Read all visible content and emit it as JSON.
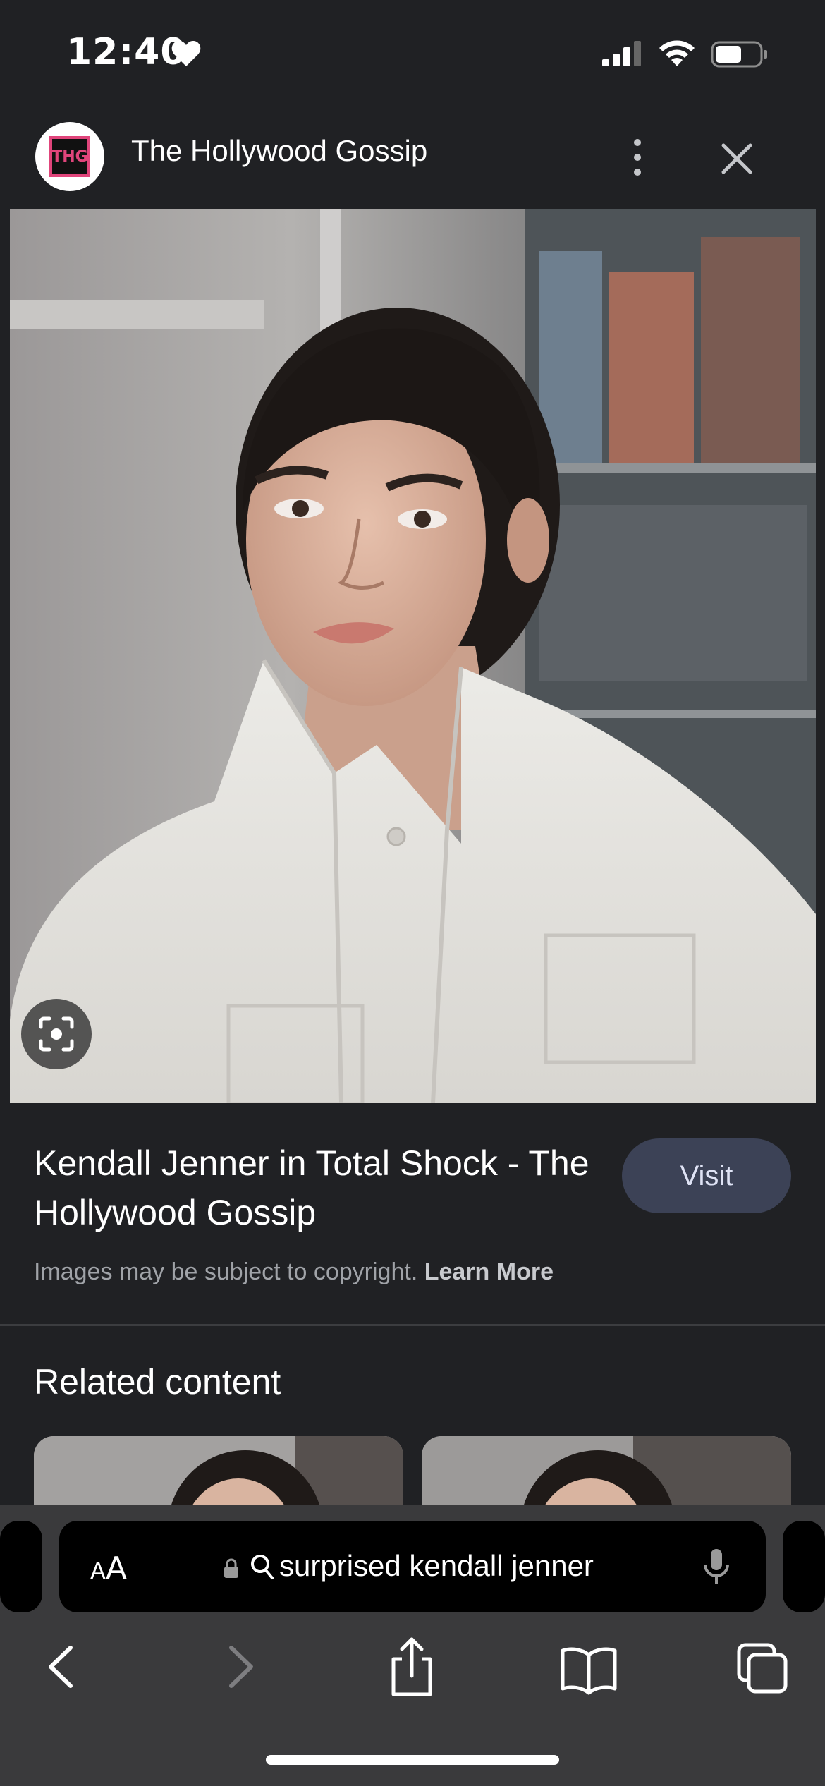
{
  "status_bar": {
    "time": "12:40",
    "icons": [
      "heart-icon",
      "cellular-signal-icon",
      "wifi-icon",
      "battery-icon"
    ]
  },
  "header": {
    "logo_text": "THG",
    "site_name": "The Hollywood Gossip",
    "icons": [
      "more-vertical-icon",
      "close-icon"
    ]
  },
  "image": {
    "lens_icon": "lens-scan-icon"
  },
  "caption": {
    "title": "Kendall Jenner in Total Shock - The Hollywood Gossip",
    "visit_label": "Visit",
    "copyright_text": "Images may be subject to copyright.",
    "learn_more": "Learn More"
  },
  "related": {
    "heading": "Related content"
  },
  "browser": {
    "aa_small": "A",
    "aa_large": "A",
    "url": "surprised kendall jenner",
    "icons": [
      "lock-icon",
      "search-icon",
      "microphone-icon",
      "back-icon",
      "forward-icon",
      "share-icon",
      "bookmarks-icon",
      "tabs-icon"
    ]
  },
  "colors": {
    "background": "#202124",
    "visit_button": "#3c4256",
    "toolbar": "#3a3a3c",
    "logo_accent": "#e0457b"
  }
}
